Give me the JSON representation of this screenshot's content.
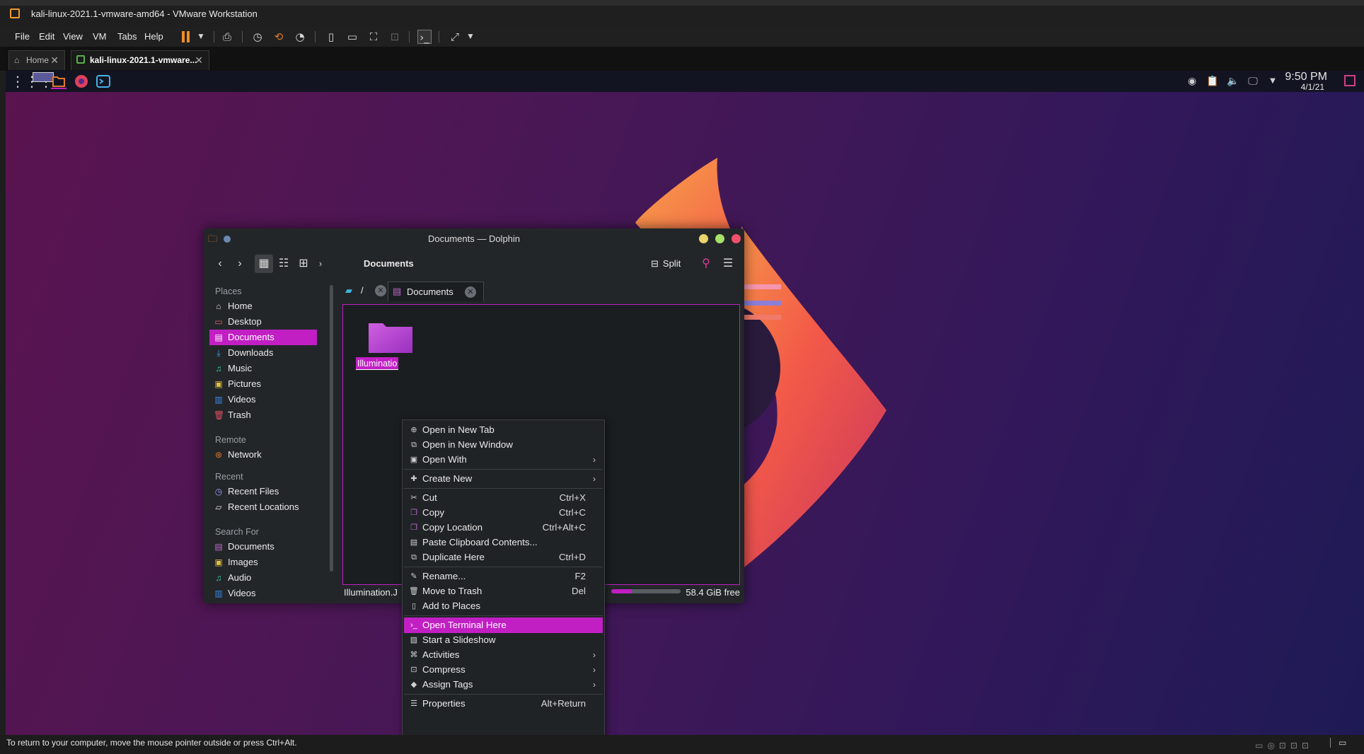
{
  "vmware": {
    "title": "kali-linux-2021.1-vmware-amd64 - VMware Workstation",
    "menu": [
      "File",
      "Edit",
      "View",
      "VM",
      "Tabs",
      "Help"
    ],
    "tabs": [
      {
        "label": "Home"
      },
      {
        "label": "kali-linux-2021.1-vmware..."
      }
    ],
    "status_message": "To return to your computer, move the mouse pointer outside or press Ctrl+Alt."
  },
  "guest_panel": {
    "time": "9:50 PM",
    "date": "4/1/21"
  },
  "dolphin": {
    "window_title": "Documents — Dolphin",
    "breadcrumb": "Documents",
    "split_label": "Split",
    "places_header": "Places",
    "places": [
      "Home",
      "Desktop",
      "Documents",
      "Downloads",
      "Music",
      "Pictures",
      "Videos",
      "Trash"
    ],
    "remote_header": "Remote",
    "remote": [
      "Network"
    ],
    "recent_header": "Recent",
    "recent": [
      "Recent Files",
      "Recent Locations"
    ],
    "search_header": "Search For",
    "search": [
      "Documents",
      "Images",
      "Audio",
      "Videos"
    ],
    "url_root": "/",
    "url_current": "Documents",
    "folder_label": "Illuminatio",
    "status_file": "Illumination.J",
    "free_space": "58.4 GiB free",
    "space_used_fraction": 0.3
  },
  "context_menu": {
    "items": [
      {
        "label": "Open in New Tab",
        "shortcut": ""
      },
      {
        "label": "Open in New Window",
        "shortcut": ""
      },
      {
        "label": "Open With",
        "shortcut": "",
        "submenu": true
      },
      {
        "label": "Create New",
        "shortcut": "",
        "submenu": true
      },
      {
        "label": "Cut",
        "shortcut": "Ctrl+X"
      },
      {
        "label": "Copy",
        "shortcut": "Ctrl+C"
      },
      {
        "label": "Copy Location",
        "shortcut": "Ctrl+Alt+C"
      },
      {
        "label": "Paste Clipboard Contents...",
        "shortcut": ""
      },
      {
        "label": "Duplicate Here",
        "shortcut": "Ctrl+D"
      },
      {
        "label": "Rename...",
        "shortcut": "F2"
      },
      {
        "label": "Move to Trash",
        "shortcut": "Del"
      },
      {
        "label": "Add to Places",
        "shortcut": ""
      },
      {
        "label": "Open Terminal Here",
        "shortcut": "",
        "highlighted": true
      },
      {
        "label": "Start a Slideshow",
        "shortcut": ""
      },
      {
        "label": "Activities",
        "shortcut": "",
        "submenu": true
      },
      {
        "label": "Compress",
        "shortcut": "",
        "submenu": true
      },
      {
        "label": "Assign Tags",
        "shortcut": "",
        "submenu": true
      },
      {
        "label": "Properties",
        "shortcut": "Alt+Return"
      }
    ]
  },
  "colors": {
    "accent": "#c11fc4",
    "vm_pause": "#f28c28"
  }
}
